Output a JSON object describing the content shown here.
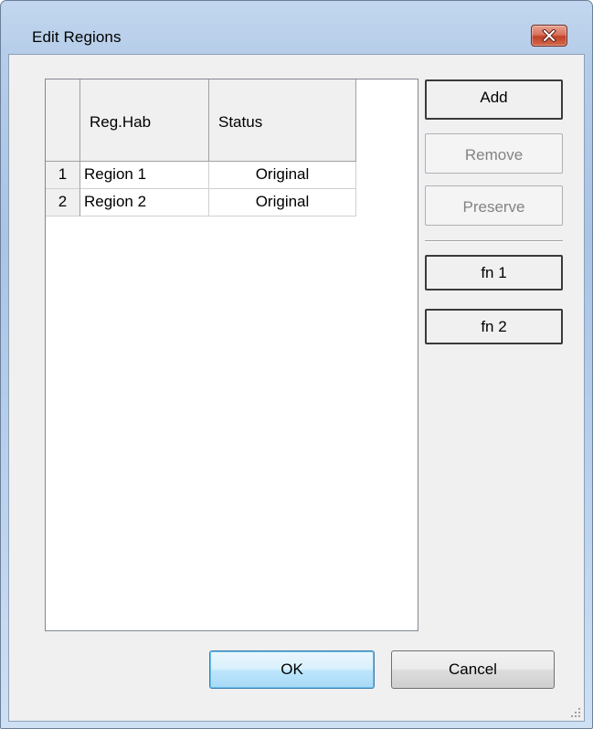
{
  "window": {
    "title": "Edit Regions"
  },
  "grid": {
    "columns": [
      "Reg.Hab",
      "Status"
    ],
    "rows": [
      {
        "index": "1",
        "region": "Region 1",
        "status": "Original"
      },
      {
        "index": "2",
        "region": "Region 2",
        "status": "Original"
      }
    ]
  },
  "side_buttons": {
    "add": "Add",
    "remove": "Remove",
    "preserve": "Preserve",
    "fn1": "fn 1",
    "fn2": "fn 2"
  },
  "footer": {
    "ok": "OK",
    "cancel": "Cancel"
  },
  "icons": {
    "close": "close-icon",
    "resize": "resize-grip-icon"
  },
  "colors": {
    "close_button": "#c24128",
    "ok_button_border": "#3c7fb1",
    "disabled_text": "#838383"
  }
}
